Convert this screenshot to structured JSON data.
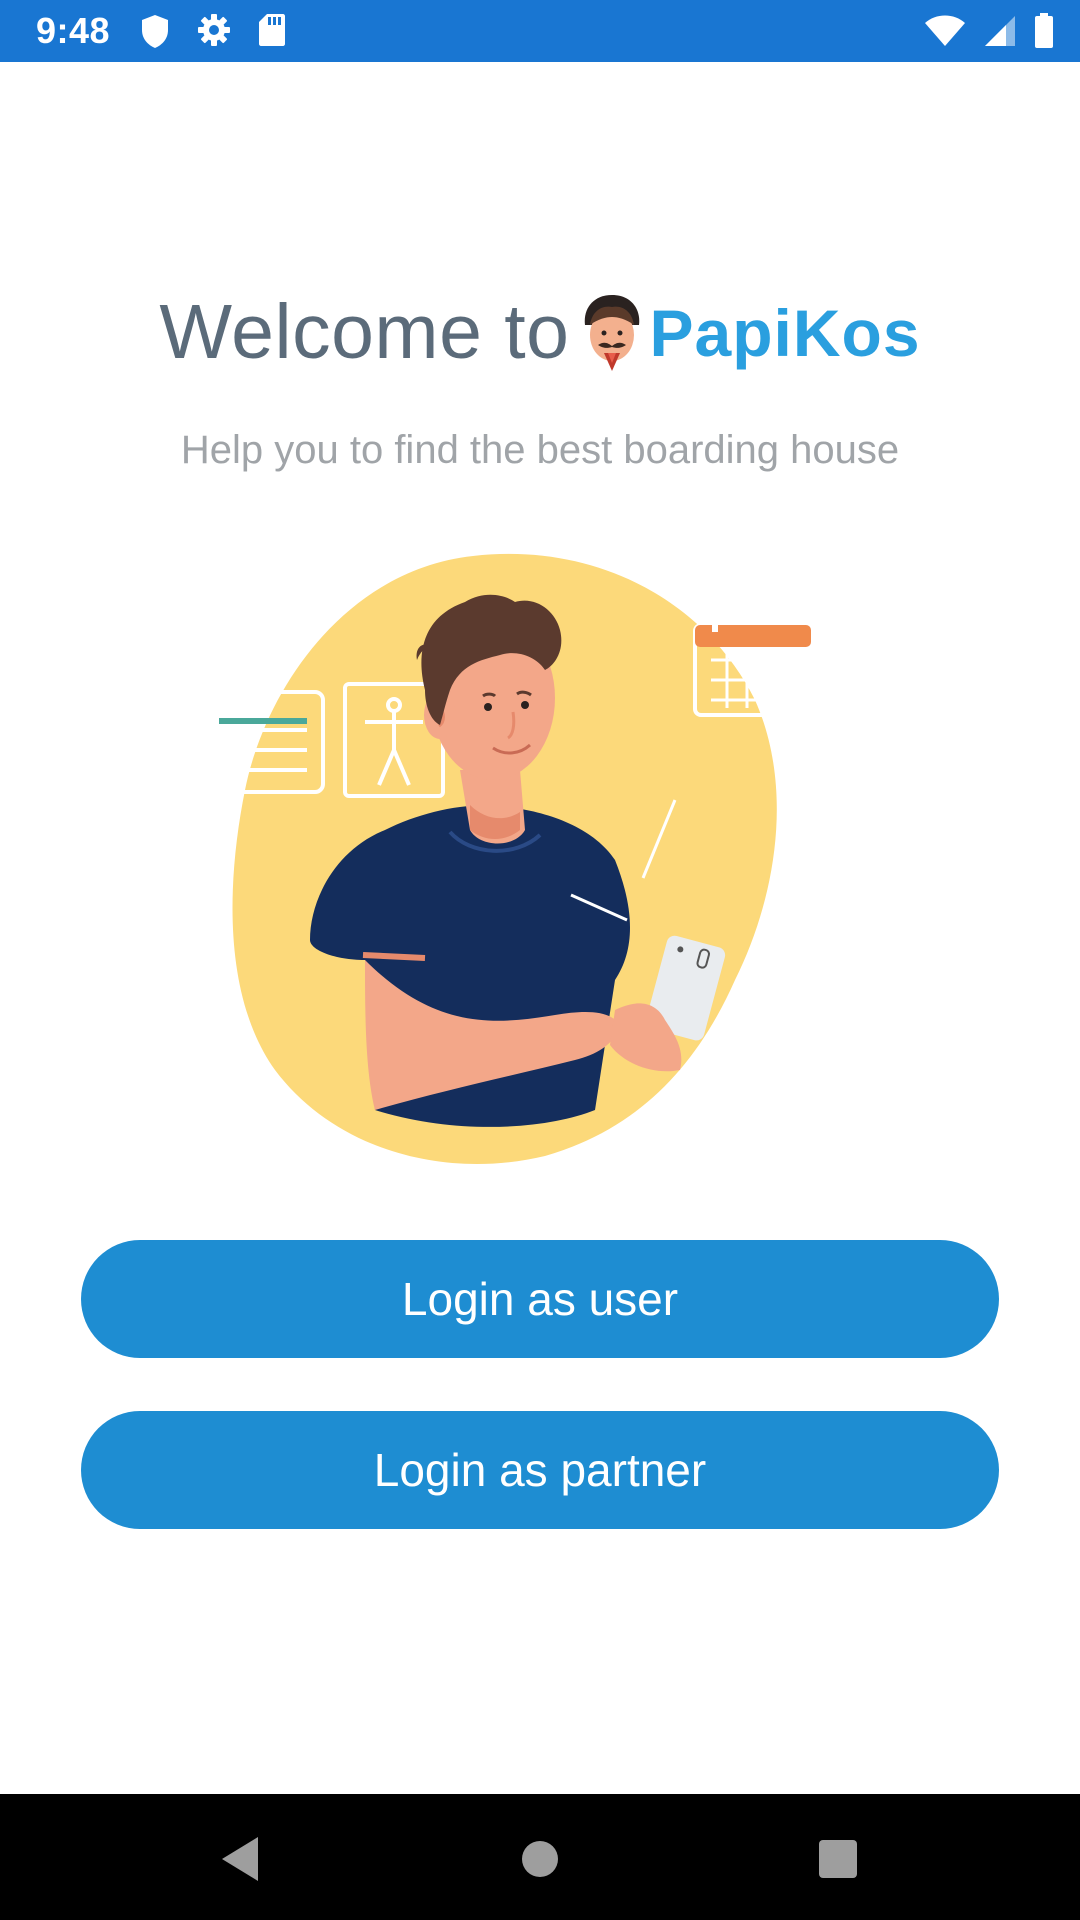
{
  "status_bar": {
    "time": "9:48",
    "left_icons": [
      "shield-icon",
      "gear-icon",
      "sd-card-icon"
    ],
    "right_icons": [
      "wifi-icon",
      "cell-signal-icon",
      "battery-icon"
    ],
    "background": "#1976d2"
  },
  "header": {
    "welcome_text": "Welcome to",
    "brand_name": "PapiKos",
    "brand_color": "#2a9fdf",
    "subtitle": "Help you to find the best boarding house"
  },
  "buttons": {
    "login_user": "Login as user",
    "login_partner": "Login as partner",
    "color": "#1e8dd2"
  },
  "nav_bar": {
    "buttons": [
      "back-icon",
      "home-icon",
      "recents-icon"
    ]
  }
}
